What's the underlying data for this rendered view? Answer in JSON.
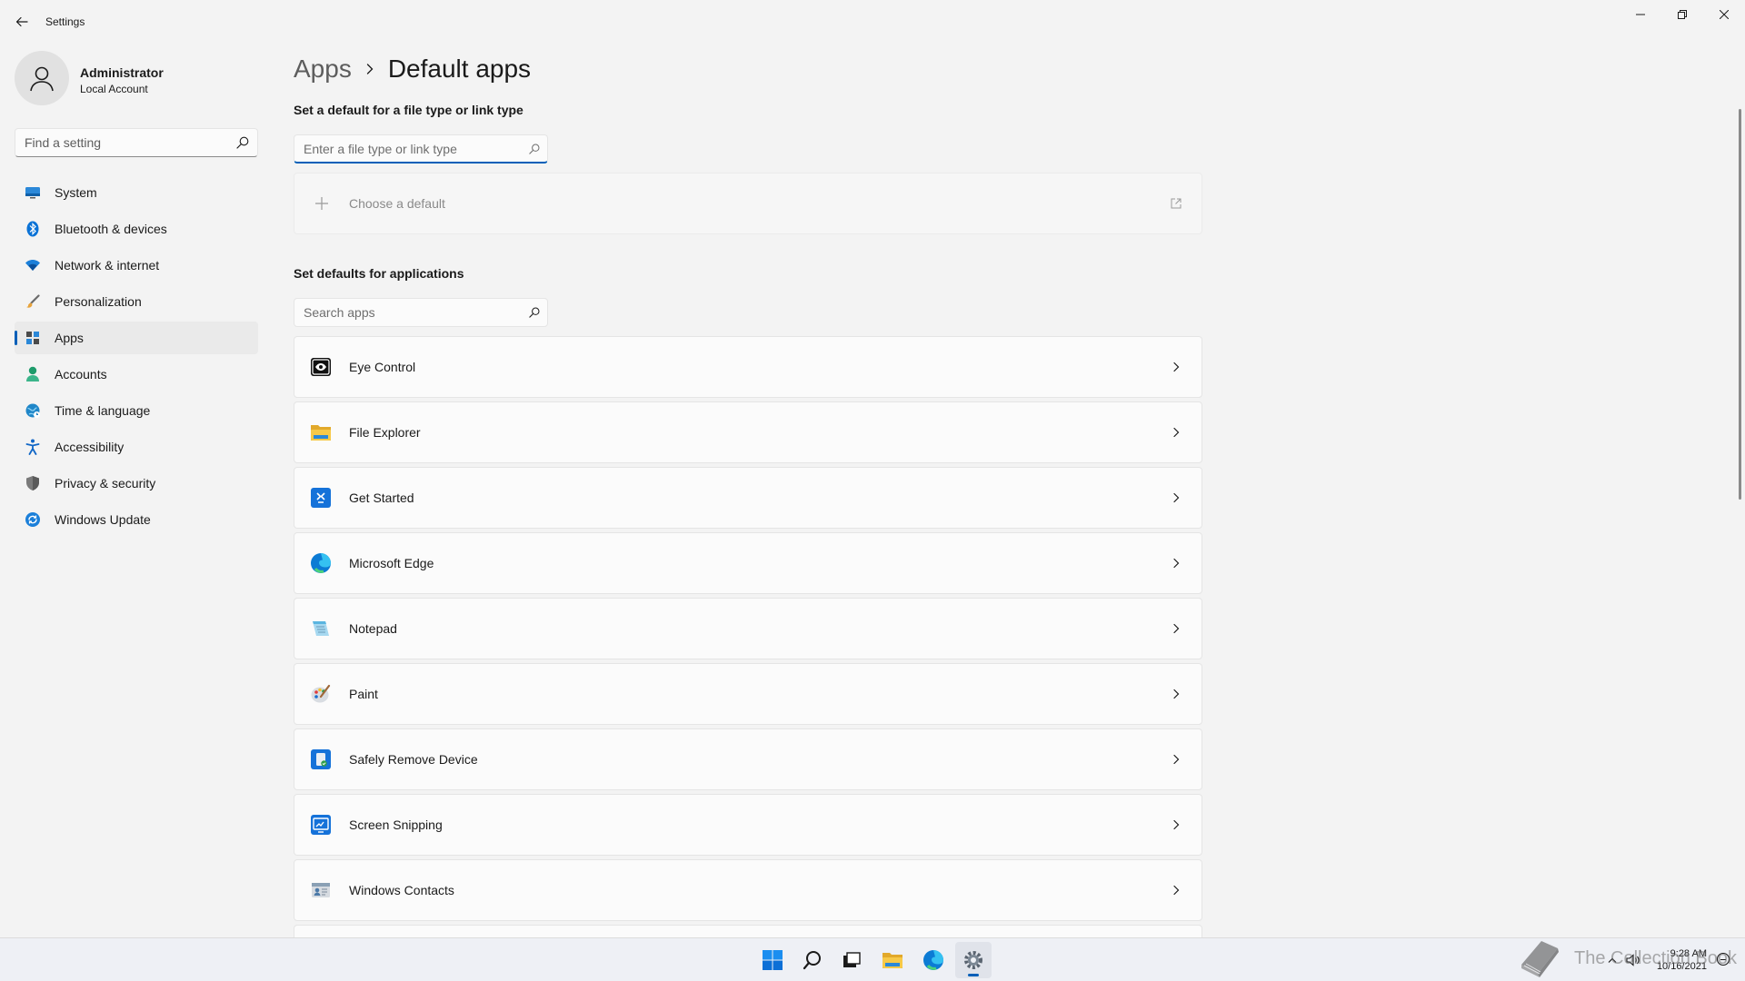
{
  "window": {
    "title": "Settings",
    "back_icon": "back-arrow-icon"
  },
  "profile": {
    "name": "Administrator",
    "account_type": "Local Account"
  },
  "sidebar": {
    "search_placeholder": "Find a setting",
    "items": [
      {
        "label": "System",
        "icon": "system-icon",
        "active": false
      },
      {
        "label": "Bluetooth & devices",
        "icon": "bluetooth-icon",
        "active": false
      },
      {
        "label": "Network & internet",
        "icon": "network-icon",
        "active": false
      },
      {
        "label": "Personalization",
        "icon": "brush-icon",
        "active": false
      },
      {
        "label": "Apps",
        "icon": "apps-icon",
        "active": true
      },
      {
        "label": "Accounts",
        "icon": "accounts-icon",
        "active": false
      },
      {
        "label": "Time & language",
        "icon": "time-language-icon",
        "active": false
      },
      {
        "label": "Accessibility",
        "icon": "accessibility-icon",
        "active": false
      },
      {
        "label": "Privacy & security",
        "icon": "shield-icon",
        "active": false
      },
      {
        "label": "Windows Update",
        "icon": "update-icon",
        "active": false
      }
    ]
  },
  "main": {
    "breadcrumb": {
      "parent": "Apps",
      "current": "Default apps"
    },
    "file_type_section": {
      "title": "Set a default for a file type or link type",
      "input_placeholder": "Enter a file type or link type",
      "choose_label": "Choose a default"
    },
    "apps_section": {
      "title": "Set defaults for applications",
      "search_placeholder": "Search apps",
      "apps": [
        {
          "label": "Eye Control",
          "icon": "eye-control-icon"
        },
        {
          "label": "File Explorer",
          "icon": "file-explorer-icon"
        },
        {
          "label": "Get Started",
          "icon": "get-started-icon"
        },
        {
          "label": "Microsoft Edge",
          "icon": "edge-icon"
        },
        {
          "label": "Notepad",
          "icon": "notepad-icon"
        },
        {
          "label": "Paint",
          "icon": "paint-icon"
        },
        {
          "label": "Safely Remove Device",
          "icon": "safely-remove-icon"
        },
        {
          "label": "Screen Snipping",
          "icon": "screen-snipping-icon"
        },
        {
          "label": "Windows Contacts",
          "icon": "contacts-icon"
        }
      ]
    }
  },
  "taskbar": {
    "apps": [
      "start-icon",
      "search-icon",
      "task-view-icon",
      "file-explorer-icon",
      "edge-icon",
      "settings-icon"
    ],
    "active_app": "settings-icon",
    "time": "9:28 AM",
    "date": "10/16/2021",
    "watermark": "The Collection Book"
  },
  "colors": {
    "accent": "#005fb8",
    "background": "#f3f3f3",
    "card": "#fbfbfb"
  }
}
